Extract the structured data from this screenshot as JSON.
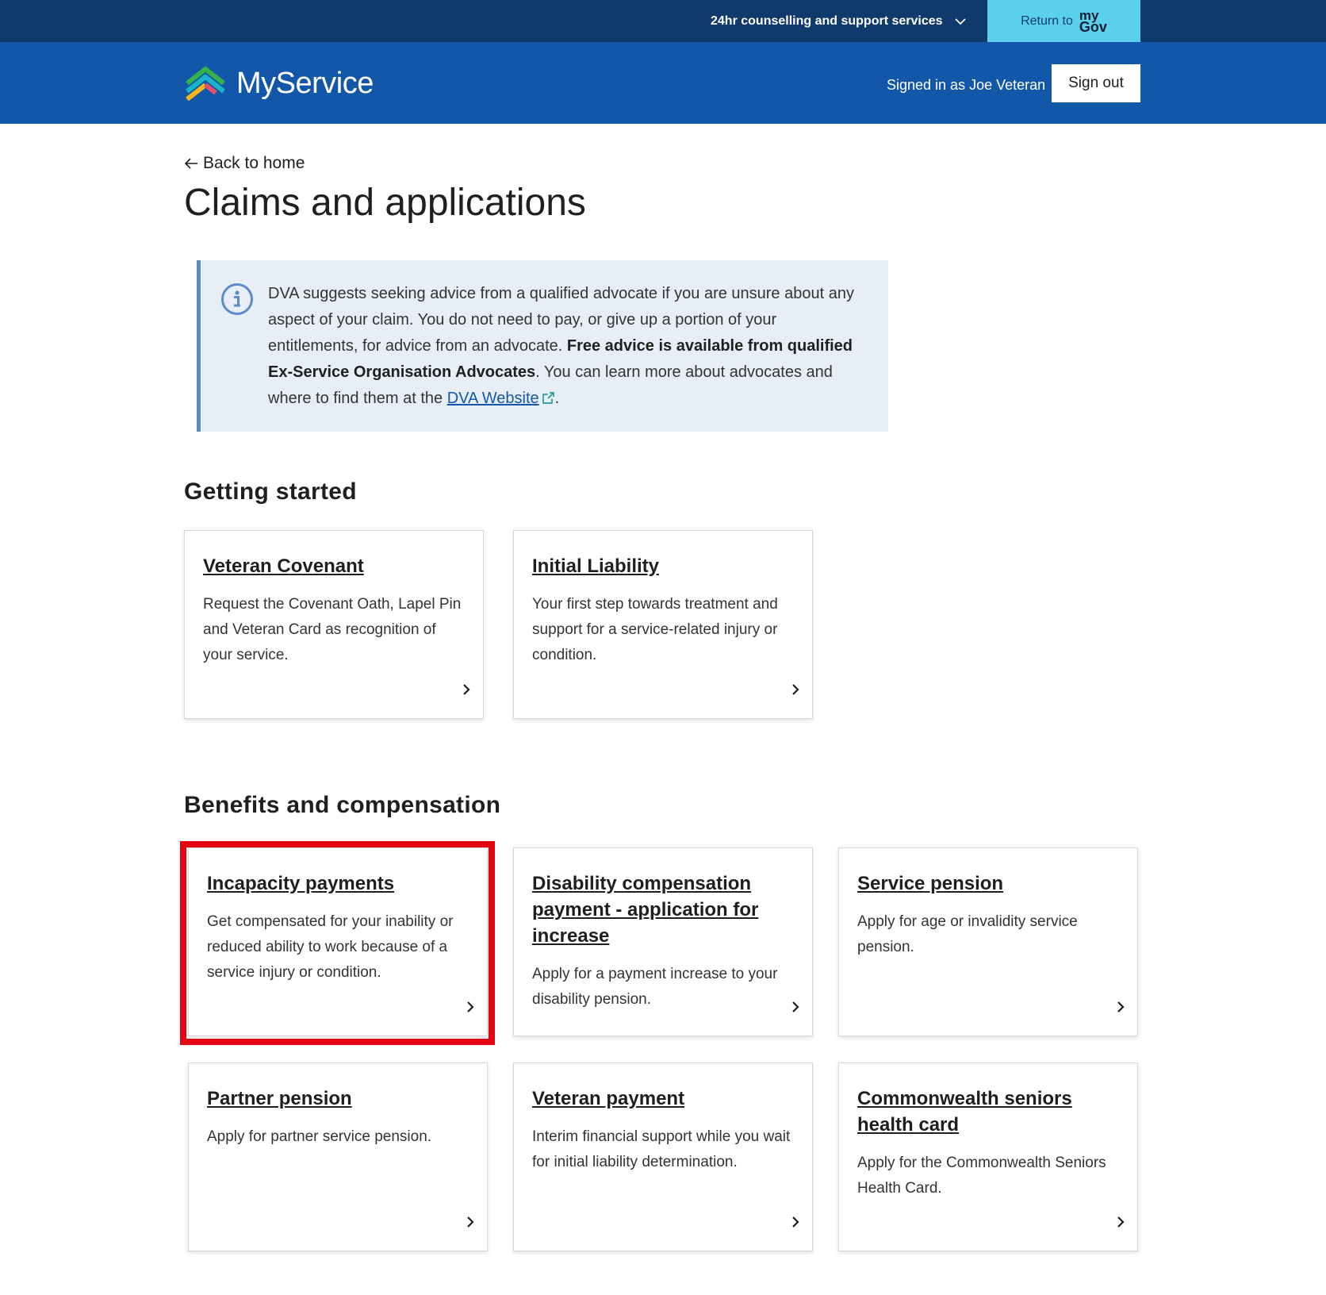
{
  "utility": {
    "support_link": "24hr counselling and support services",
    "return_label": "Return to",
    "mygov_l1": "my",
    "mygov_l2": "Gov"
  },
  "header": {
    "brand_name": "MyService",
    "signed_in": "Signed in as Joe Veteran",
    "sign_out": "Sign out"
  },
  "main": {
    "back_link": "Back to home",
    "page_title": "Claims and applications",
    "info": {
      "text_1": "DVA suggests seeking advice from a qualified advocate if you are unsure about any aspect of your claim. You do not need to pay, or give up a portion of your entitlements, for advice from an advocate. ",
      "bold": "Free advice is available from qualified Ex-Service Organisation Advocates",
      "text_2": ". You can learn more about advocates and where to find them at the ",
      "link": "DVA Website",
      "text_3": "."
    },
    "getting_started": {
      "title": "Getting started",
      "cards": [
        {
          "title": "Veteran Covenant",
          "desc": "Request the Covenant Oath, Lapel Pin and Veteran Card as recognition of your service."
        },
        {
          "title": "Initial Liability",
          "desc": "Your first step towards treatment and support for a service-related injury or condition."
        }
      ]
    },
    "benefits": {
      "title": "Benefits and compensation",
      "cards": [
        {
          "title": "Incapacity payments",
          "desc": "Get compensated for your inability or reduced ability to work because of a service injury or condition."
        },
        {
          "title": "Disability compensation payment - application for increase",
          "desc": "Apply for a payment increase to your disability pension."
        },
        {
          "title": "Service pension",
          "desc": "Apply for age or invalidity service pension."
        },
        {
          "title": "Partner pension",
          "desc": "Apply for partner service pension."
        },
        {
          "title": "Veteran payment",
          "desc": "Interim financial support while you wait for initial liability determination."
        },
        {
          "title": "Commonwealth seniors health card",
          "desc": "Apply for the Commonwealth Seniors Health Card."
        }
      ]
    }
  },
  "colors": {
    "utility_bar": "#103a6b",
    "header": "#1358a8",
    "mygov_button": "#5ad0ee",
    "info_box": "#e8eef6",
    "highlight": "#e30613"
  }
}
